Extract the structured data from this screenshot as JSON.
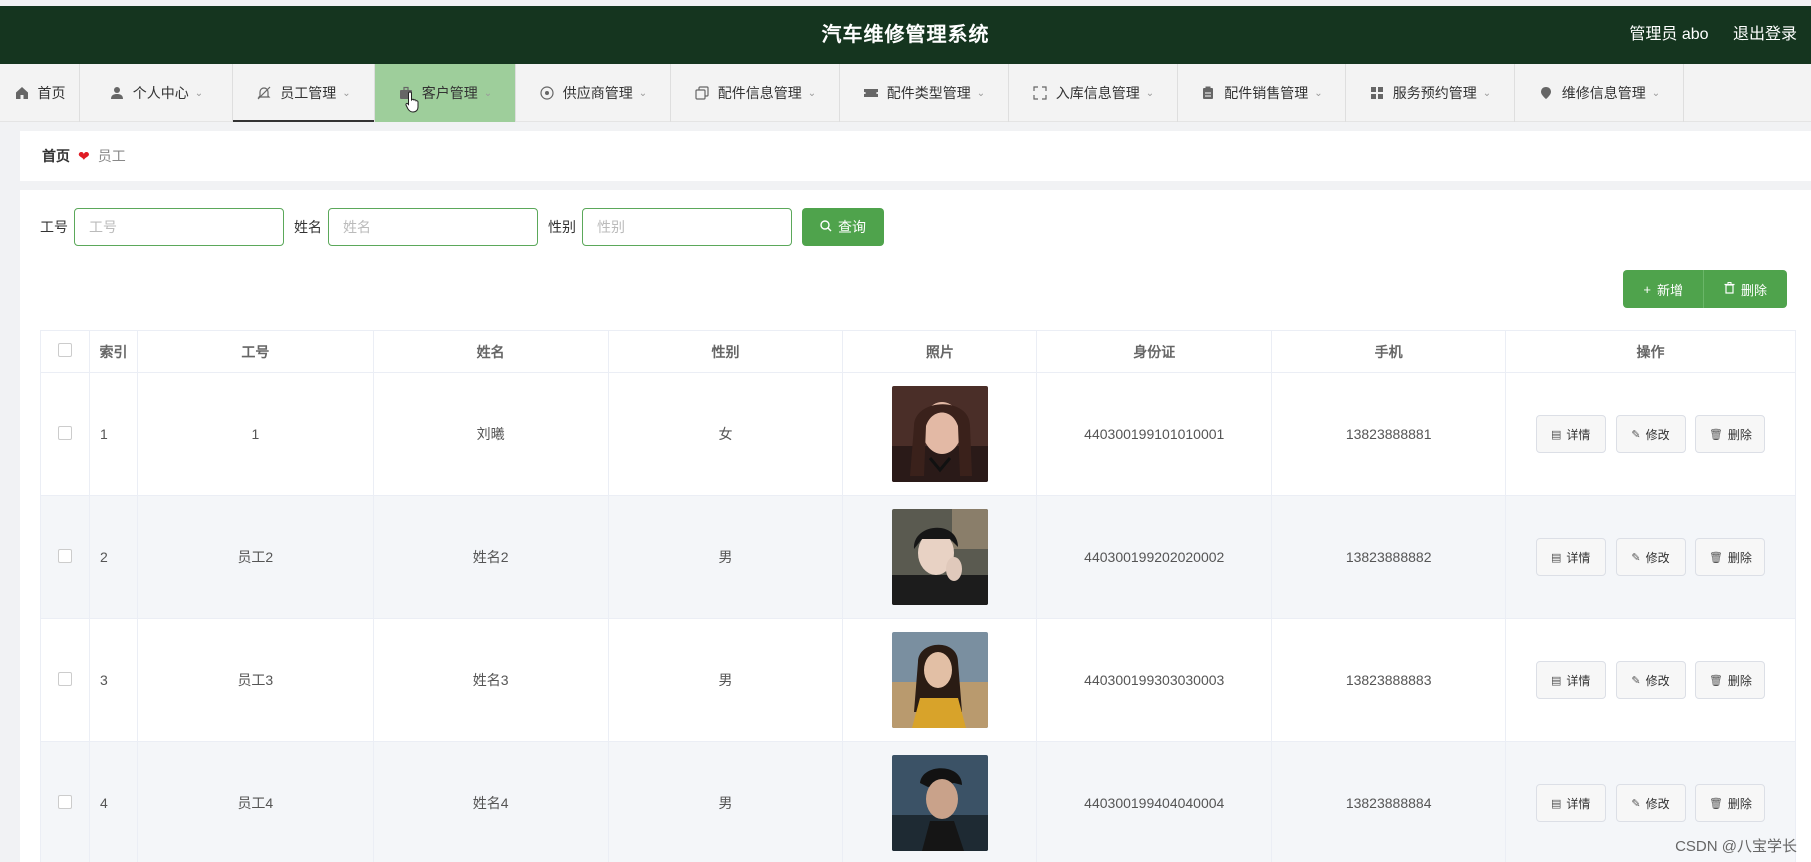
{
  "header": {
    "title": "汽车维修管理系统",
    "user_label": "管理员 abo",
    "logout_label": "退出登录"
  },
  "nav": {
    "items": [
      {
        "label": "首页",
        "icon": "home-icon"
      },
      {
        "label": "个人中心",
        "icon": "user-icon"
      },
      {
        "label": "员工管理",
        "icon": "bell-off-icon"
      },
      {
        "label": "客户管理",
        "icon": "briefcase-icon"
      },
      {
        "label": "供应商管理",
        "icon": "compass-icon"
      },
      {
        "label": "配件信息管理",
        "icon": "copy-icon"
      },
      {
        "label": "配件类型管理",
        "icon": "ticket-icon"
      },
      {
        "label": "入库信息管理",
        "icon": "fullscreen-icon"
      },
      {
        "label": "配件销售管理",
        "icon": "document-icon"
      },
      {
        "label": "服务预约管理",
        "icon": "grid-icon"
      },
      {
        "label": "维修信息管理",
        "icon": "location-icon"
      }
    ]
  },
  "breadcrumb": {
    "home": "首页",
    "current": "员工"
  },
  "search": {
    "fields": [
      {
        "label": "工号",
        "placeholder": "工号",
        "value": ""
      },
      {
        "label": "姓名",
        "placeholder": "姓名",
        "value": ""
      },
      {
        "label": "性别",
        "placeholder": "性别",
        "value": ""
      }
    ],
    "query_label": "查询"
  },
  "actions": {
    "add_label": "新增",
    "delete_label": "删除"
  },
  "table": {
    "columns": [
      "索引",
      "工号",
      "姓名",
      "性别",
      "照片",
      "身份证",
      "手机",
      "操作"
    ],
    "rows": [
      {
        "index": "1",
        "job_no": "1",
        "name": "刘曦",
        "gender": "女",
        "id_card": "440300199101010001",
        "phone": "13823888881"
      },
      {
        "index": "2",
        "job_no": "员工2",
        "name": "姓名2",
        "gender": "男",
        "id_card": "440300199202020002",
        "phone": "13823888882"
      },
      {
        "index": "3",
        "job_no": "员工3",
        "name": "姓名3",
        "gender": "男",
        "id_card": "440300199303030003",
        "phone": "13823888883"
      },
      {
        "index": "4",
        "job_no": "员工4",
        "name": "姓名4",
        "gender": "男",
        "id_card": "440300199404040004",
        "phone": "13823888884"
      }
    ],
    "row_actions": {
      "detail": "详情",
      "edit": "修改",
      "delete": "删除"
    }
  },
  "watermark": "CSDN @八宝学长",
  "colors": {
    "header_bg": "#15351f",
    "accent_green": "#4fa34c",
    "active_tab_bg": "#9ece9b"
  }
}
